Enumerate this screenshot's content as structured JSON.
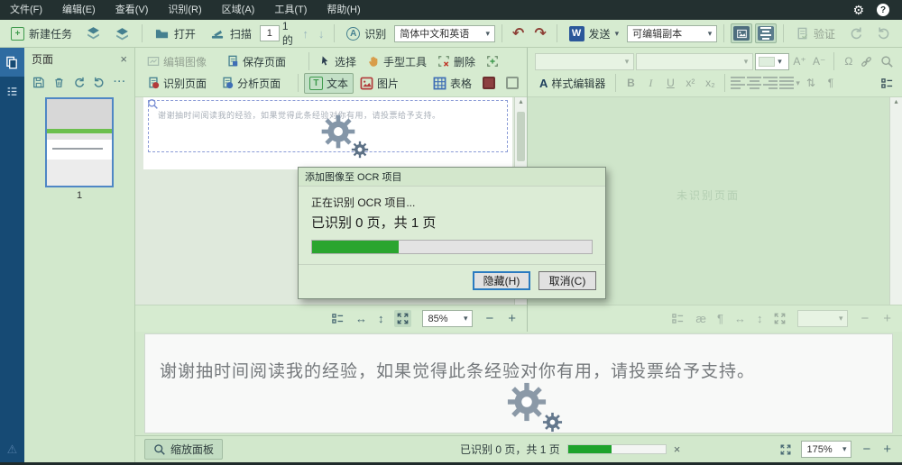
{
  "menubar": {
    "items": [
      "文件(F)",
      "编辑(E)",
      "查看(V)",
      "识别(R)",
      "区域(A)",
      "工具(T)",
      "帮助(H)"
    ]
  },
  "toolbar": {
    "new_task": "新建任务",
    "open": "打开",
    "scan": "扫描",
    "page_value": "1",
    "page_of": "1的",
    "recognize": "识别",
    "language": "简体中文和英语",
    "send": "发送",
    "format_copy": "可编辑副本",
    "verify": "验证"
  },
  "pages_panel": {
    "title": "页面",
    "page_number": "1"
  },
  "image_panel": {
    "edit_image": "编辑图像",
    "save_page": "保存页面",
    "recognize_page": "识别页面",
    "analyze_page": "分析页面",
    "select": "选择",
    "hand": "手型工具",
    "delete": "删除",
    "text": "文本",
    "picture": "图片",
    "table": "表格",
    "content_text": "谢谢抽时间阅读我的经验，如果觉得此条经验对你有用，请投票给予支持。",
    "zoom": "85%"
  },
  "text_panel": {
    "style_editor": "样式编辑器",
    "bold": "B",
    "italic": "I",
    "underline": "U",
    "superscript": "x²",
    "subscript": "x₂",
    "watermark": "未识别页面"
  },
  "dialog": {
    "title": "添加图像至 OCR 项目",
    "status_line": "正在识别 OCR 项目...",
    "progress_line": "已识别 0 页，共 1 页",
    "progress_percent": 31,
    "hide_button": "隐藏(H)",
    "cancel_button": "取消(C)"
  },
  "zoom_panel": {
    "text": "谢谢抽时间阅读我的经验，如果觉得此条经验对你有用，请投票给予支持。"
  },
  "status_bar": {
    "zoom_panel_button": "缩放面板",
    "recognized": "已识别 0 页，共 1 页",
    "progress_percent": 45,
    "zoom": "175%"
  },
  "icons": {
    "gear": "⚙",
    "help": "?",
    "recognize_a": "A",
    "undo": "↶",
    "redo": "↷",
    "dropdown": "▾",
    "up": "↑",
    "down": "↓",
    "close": "×",
    "more": "···",
    "send_w": "W",
    "minus": "−",
    "plus": "+",
    "fit_width": "↔",
    "fit_height": "↕",
    "omega": "Ω",
    "para": "¶",
    "ae": "æ",
    "line_spacing": "⇅",
    "warning": "⚠",
    "font_up": "A⁺",
    "font_down": "A⁻",
    "region_t": "T",
    "style_a": "A",
    "scroll_up": "▴"
  }
}
